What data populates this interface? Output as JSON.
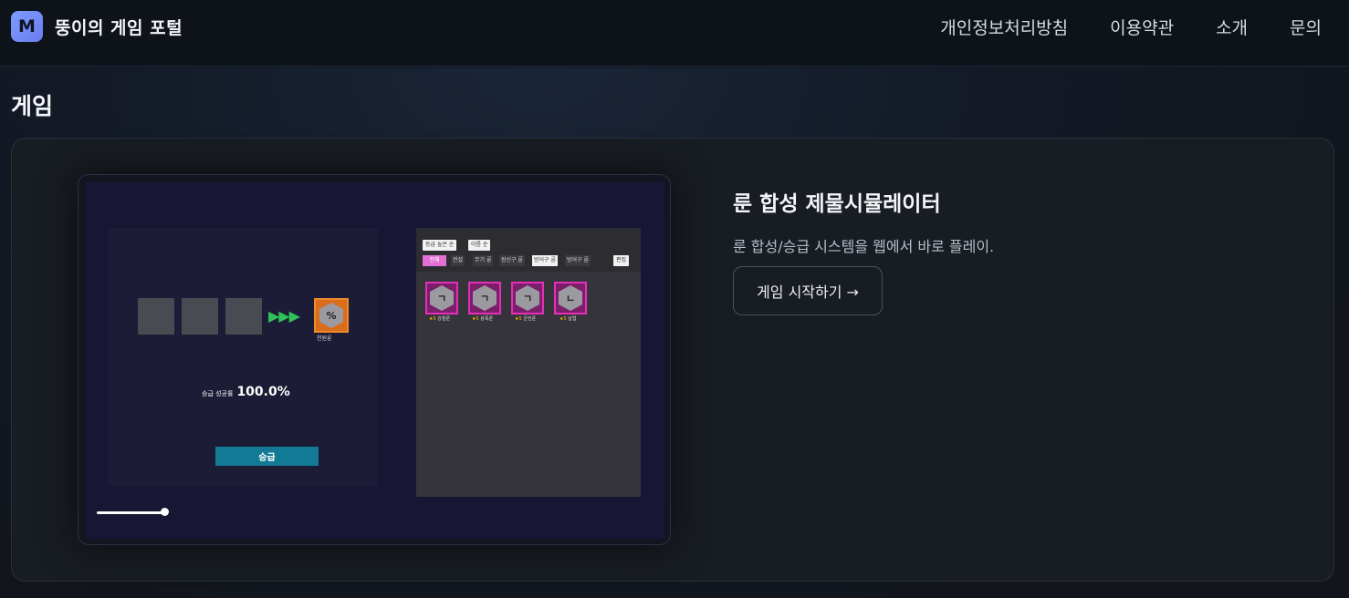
{
  "header": {
    "logo_letter": "M",
    "site_title": "뚱이의 게임 포털",
    "nav": [
      {
        "label": "개인정보처리방침"
      },
      {
        "label": "이용약관"
      },
      {
        "label": "소개"
      },
      {
        "label": "문의"
      }
    ]
  },
  "main": {
    "section_title": "게임",
    "game": {
      "title": "룬 합성 제물시뮬레이터",
      "description": "룬 합성/승급 시스템을 웹에서 바로 플레이.",
      "start_label": "게임 시작하기 →",
      "thumbnail": {
        "arrows": "▶▶▶",
        "result_rune_glyph": "%",
        "result_rune_label": "천원룬",
        "rate_label": "승급 성공률",
        "rate_value": "100.0%",
        "upgrade_label": "승급",
        "sort_options": [
          "등급 높은 순",
          "이름 순"
        ],
        "tabs": [
          "전체",
          "전설",
          "무기 룬",
          "장신구 룬",
          "방어구 룬",
          "방어구 룬"
        ],
        "edit_label": "편집",
        "runes": [
          {
            "glyph": "ㄱ",
            "star": "★5",
            "name": "강철룬"
          },
          {
            "glyph": "ㄱ",
            "star": "★5",
            "name": "광폭룬"
          },
          {
            "glyph": "ㄱ",
            "star": "★5",
            "name": "균전룬"
          },
          {
            "glyph": "ㄴ",
            "star": "★5",
            "name": "날렵"
          }
        ]
      }
    }
  },
  "colors": {
    "accent": "#7d9cff",
    "upgrade_button": "#127a94",
    "rune_border": "#e52fb8",
    "result_rune": "#d96d1b"
  }
}
